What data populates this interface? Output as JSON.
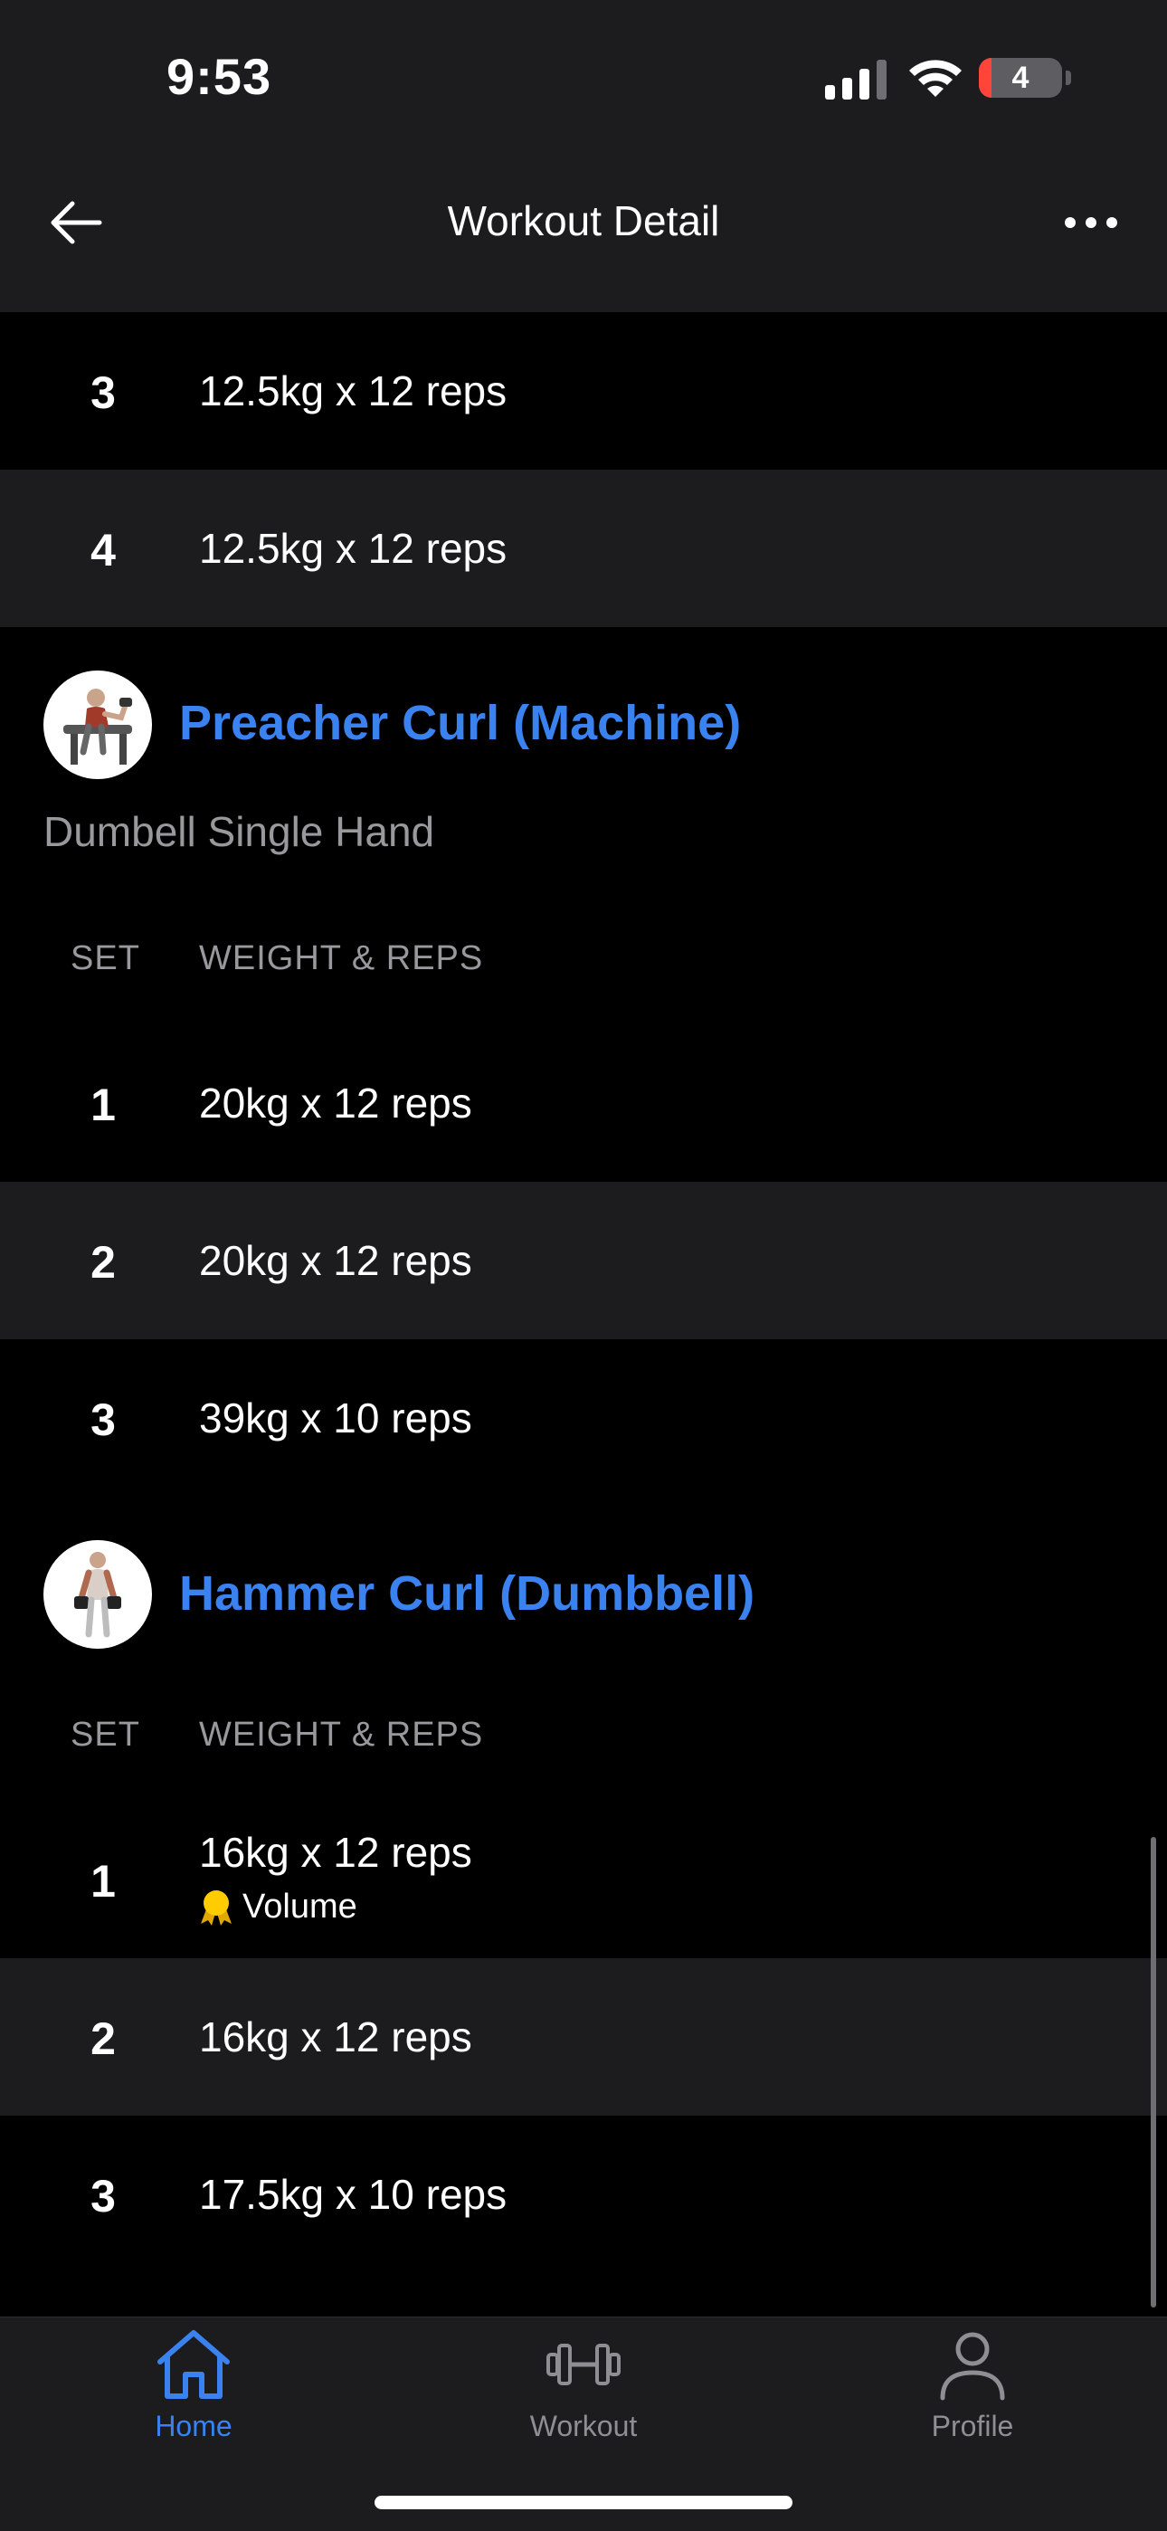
{
  "status_bar": {
    "time": "9:53",
    "battery": "4"
  },
  "nav": {
    "title": "Workout Detail"
  },
  "top_rows": [
    {
      "set": "3",
      "text": "12.5kg x 12 reps"
    },
    {
      "set": "4",
      "text": "12.5kg x 12 reps"
    }
  ],
  "exercises": [
    {
      "name": "Preacher Curl (Machine)",
      "note": "Dumbell Single Hand",
      "col_set": "SET",
      "col_weight_reps": "WEIGHT & REPS",
      "sets": [
        {
          "set": "1",
          "text": "20kg x 12 reps"
        },
        {
          "set": "2",
          "text": "20kg x 12 reps"
        },
        {
          "set": "3",
          "text": "39kg x 10 reps"
        }
      ]
    },
    {
      "name": "Hammer Curl (Dumbbell)",
      "col_set": "SET",
      "col_weight_reps": "WEIGHT & REPS",
      "sets": [
        {
          "set": "1",
          "text": "16kg x 12 reps",
          "badge": "Volume"
        },
        {
          "set": "2",
          "text": "16kg x 12 reps"
        },
        {
          "set": "3",
          "text": "17.5kg x 10 reps"
        }
      ]
    }
  ],
  "tabs": [
    {
      "label": "Home",
      "icon": "home-icon",
      "active": true
    },
    {
      "label": "Workout",
      "icon": "dumbbell-icon",
      "active": false
    },
    {
      "label": "Profile",
      "icon": "person-icon",
      "active": false
    }
  ],
  "colors": {
    "accent": "#3a82f0",
    "background": "#000000",
    "row_alt": "#1c1c1e",
    "muted": "#98989d"
  }
}
